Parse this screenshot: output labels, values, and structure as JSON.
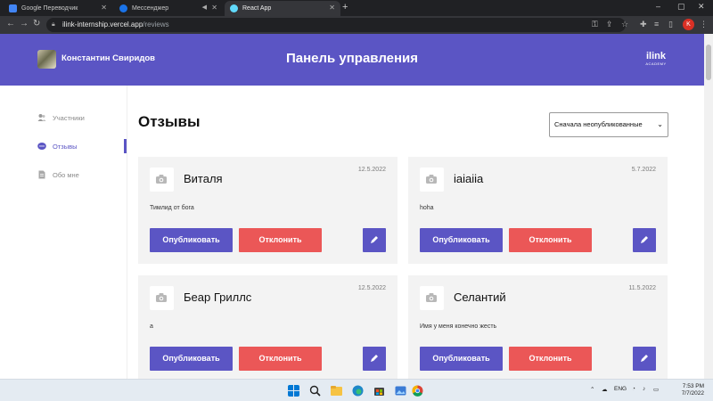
{
  "browser": {
    "tabs": [
      {
        "title": "Google Переводчик"
      },
      {
        "title": "Мессенджер"
      },
      {
        "title": "React App"
      }
    ],
    "url_host": "ilink-internship.vercel.app",
    "url_path": "/reviews",
    "profile_initial": "K"
  },
  "header": {
    "user_name": "Константин Свиридов",
    "title": "Панель управления",
    "logo_main": "ilink",
    "logo_sub": "ACADEMY"
  },
  "sidebar": {
    "items": [
      {
        "label": "Участники",
        "icon": "users-icon",
        "active": false
      },
      {
        "label": "Отзывы",
        "icon": "reviews-icon",
        "active": true
      },
      {
        "label": "Обо мне",
        "icon": "document-icon",
        "active": false
      }
    ]
  },
  "main": {
    "title": "Отзывы",
    "sort": {
      "selected": "Сначала неопубликованные"
    },
    "publish_label": "Опубликовать",
    "reject_label": "Отклонить",
    "reviews": [
      {
        "name": "Виталя",
        "date": "12.5.2022",
        "text": "Тимлид от бога"
      },
      {
        "name": "iaiaiia",
        "date": "5.7.2022",
        "text": "hoha"
      },
      {
        "name": "Беар Гриллс",
        "date": "12.5.2022",
        "text": "a"
      },
      {
        "name": "Селантий",
        "date": "11.5.2022",
        "text": "Имя у меня конечно жесть"
      }
    ]
  },
  "taskbar": {
    "language": "ENG",
    "time": "7:53 PM",
    "date": "7/7/2022"
  },
  "colors": {
    "accent": "#5b55c4",
    "danger": "#eb5757",
    "card_bg": "#f3f3f3"
  }
}
